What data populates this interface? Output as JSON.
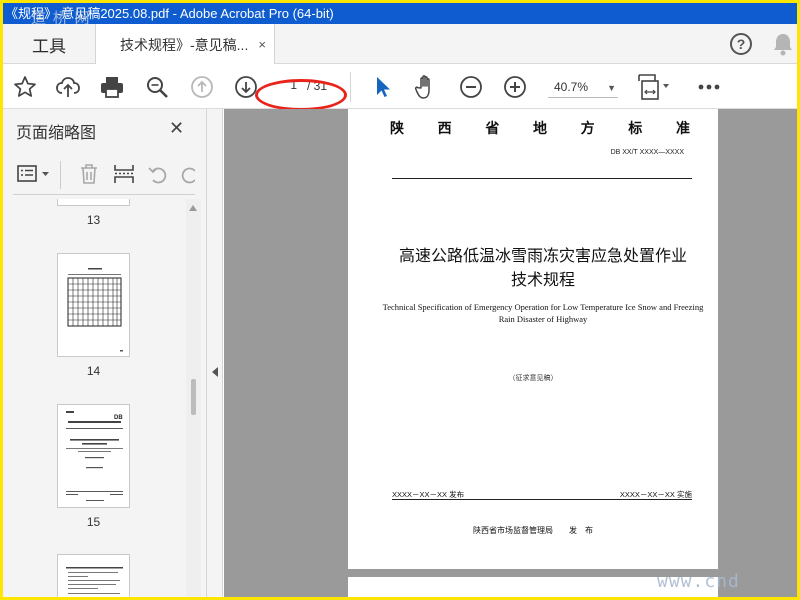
{
  "window": {
    "title": "《规程》-意见稿2025.08.pdf - Adobe Acrobat Pro (64-bit)",
    "watermark_top": "道 桥 网"
  },
  "tabs": {
    "tools_label": "工具",
    "document_label": "技术规程》-意见稿...",
    "close_glyph": "×"
  },
  "header_icons": [
    "help-icon",
    "bell-icon"
  ],
  "toolbar": {
    "icons": [
      "star-icon",
      "cloud-upload-icon",
      "print-icon",
      "search-zoom-icon",
      "page-up-icon",
      "page-down-icon",
      "select-arrow-icon",
      "hand-icon",
      "zoom-out-icon",
      "zoom-in-icon",
      "fit-page-icon",
      "more-icon"
    ],
    "current_page": "1",
    "total_pages": "/ 31",
    "zoom_value": "40.7%",
    "highlight_color": "#e8231a"
  },
  "sidebar": {
    "title": "页面缩略图",
    "close_glyph": "✕",
    "tool_icons": [
      "options-icon",
      "delete-icon",
      "insert-page-icon",
      "undo-icon",
      "redo-icon"
    ],
    "thumbnails": [
      {
        "label": "13"
      },
      {
        "label": "14"
      },
      {
        "label": "15"
      }
    ],
    "thumb15_code": "DB"
  },
  "document": {
    "header_chars": [
      "陕",
      "西",
      "省",
      "地",
      "方",
      "标",
      "准"
    ],
    "standard_code": "DB XX/T  XXXX—XXXX",
    "title_cn_line1": "高速公路低温冰雪雨冻灾害应急处置作业",
    "title_cn_line2": "技术规程",
    "title_en": "Technical Specification of Emergency Operation for Low Temperature Ice Snow and Freezing Rain Disaster of Highway",
    "draft_label": "（征求意见稿）",
    "publish_date": "XXXX－XX－XX 发布",
    "implement_date": "XXXX－XX－XX 实施",
    "issuer": "陕西省市场监督管理局　　发　布"
  },
  "watermark_bottom": "www.cnd"
}
